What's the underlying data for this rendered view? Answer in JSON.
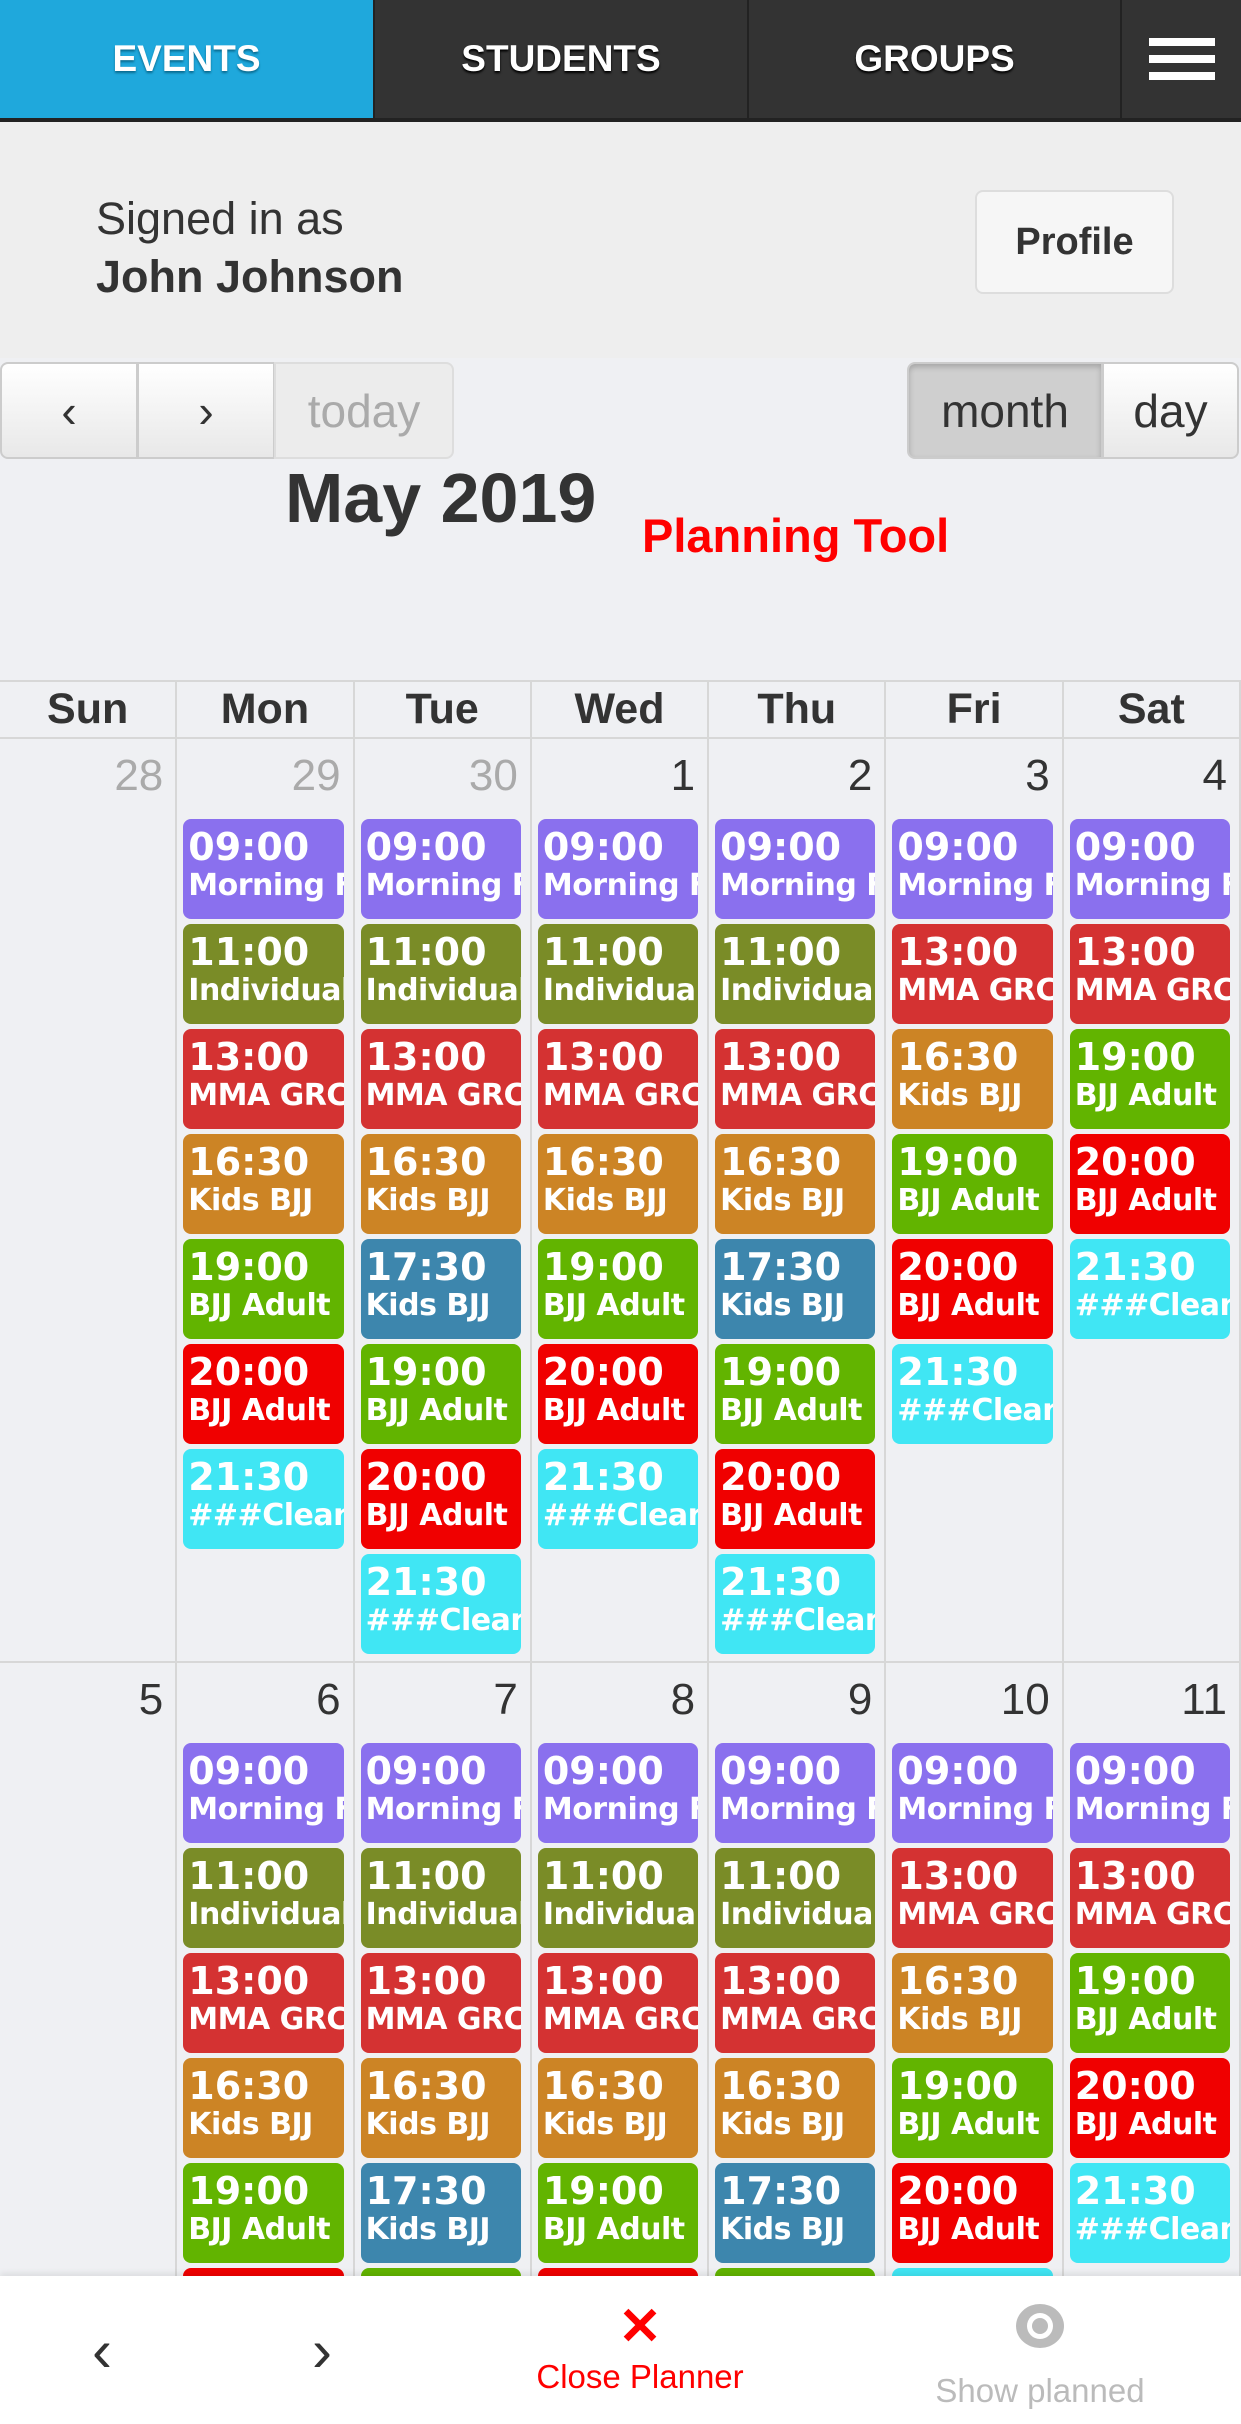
{
  "nav": {
    "tabs": [
      {
        "label": "EVENTS",
        "active": true
      },
      {
        "label": "STUDENTS"
      },
      {
        "label": "GROUPS"
      }
    ],
    "menu_icon": "hamburger-icon",
    "active_color": "#1fa8dc"
  },
  "user": {
    "signed_in_label": "Signed in as",
    "name": "John Johnson",
    "profile_button": "Profile"
  },
  "toolbar": {
    "prev": "‹",
    "next": "›",
    "today": "today",
    "views": [
      {
        "label": "month",
        "active": true
      },
      {
        "label": "day"
      }
    ]
  },
  "calendar": {
    "title": "May 2019",
    "subtitle": "Planning Tool",
    "weekdays": [
      "Sun",
      "Mon",
      "Tue",
      "Wed",
      "Thu",
      "Fri",
      "Sat"
    ],
    "palette": {
      "morning": "#8a70ee",
      "individual": "#7a8c27",
      "mma": "#d43232",
      "kids": "#cc8425",
      "bjj": "#62b400",
      "kids2": "#3d86ad",
      "adult": "#f00000",
      "clean": "#40e6f4"
    },
    "weeks": [
      {
        "days": [
          {
            "date": "28",
            "other": true,
            "events": []
          },
          {
            "date": "29",
            "other": true,
            "events": [
              {
                "time": "09:00",
                "title": "Morning F",
                "color": "morning"
              },
              {
                "time": "11:00",
                "title": "Individual",
                "color": "individual"
              },
              {
                "time": "13:00",
                "title": "MMA GRC",
                "color": "mma"
              },
              {
                "time": "16:30",
                "title": "Kids BJJ",
                "color": "kids"
              },
              {
                "time": "19:00",
                "title": "BJJ Adult",
                "color": "bjj"
              },
              {
                "time": "20:00",
                "title": "BJJ Adult",
                "color": "adult"
              },
              {
                "time": "21:30",
                "title": "###Clean",
                "color": "clean"
              }
            ]
          },
          {
            "date": "30",
            "other": true,
            "events": [
              {
                "time": "09:00",
                "title": "Morning F",
                "color": "morning"
              },
              {
                "time": "11:00",
                "title": "Individual",
                "color": "individual"
              },
              {
                "time": "13:00",
                "title": "MMA GRC",
                "color": "mma"
              },
              {
                "time": "16:30",
                "title": "Kids BJJ",
                "color": "kids"
              },
              {
                "time": "17:30",
                "title": "Kids BJJ",
                "color": "kids2"
              },
              {
                "time": "19:00",
                "title": "BJJ Adult",
                "color": "bjj"
              },
              {
                "time": "20:00",
                "title": "BJJ Adult",
                "color": "adult"
              },
              {
                "time": "21:30",
                "title": "###Clean",
                "color": "clean"
              }
            ]
          },
          {
            "date": "1",
            "events": [
              {
                "time": "09:00",
                "title": "Morning F",
                "color": "morning"
              },
              {
                "time": "11:00",
                "title": "Individual",
                "color": "individual"
              },
              {
                "time": "13:00",
                "title": "MMA GRC",
                "color": "mma"
              },
              {
                "time": "16:30",
                "title": "Kids BJJ",
                "color": "kids"
              },
              {
                "time": "19:00",
                "title": "BJJ Adult",
                "color": "bjj"
              },
              {
                "time": "20:00",
                "title": "BJJ Adult",
                "color": "adult"
              },
              {
                "time": "21:30",
                "title": "###Clean",
                "color": "clean"
              }
            ]
          },
          {
            "date": "2",
            "events": [
              {
                "time": "09:00",
                "title": "Morning F",
                "color": "morning"
              },
              {
                "time": "11:00",
                "title": "Individual",
                "color": "individual"
              },
              {
                "time": "13:00",
                "title": "MMA GRC",
                "color": "mma"
              },
              {
                "time": "16:30",
                "title": "Kids BJJ",
                "color": "kids"
              },
              {
                "time": "17:30",
                "title": "Kids BJJ",
                "color": "kids2"
              },
              {
                "time": "19:00",
                "title": "BJJ Adult",
                "color": "bjj"
              },
              {
                "time": "20:00",
                "title": "BJJ Adult",
                "color": "adult"
              },
              {
                "time": "21:30",
                "title": "###Clean",
                "color": "clean"
              }
            ]
          },
          {
            "date": "3",
            "events": [
              {
                "time": "09:00",
                "title": "Morning F",
                "color": "morning"
              },
              {
                "time": "13:00",
                "title": "MMA GRC",
                "color": "mma"
              },
              {
                "time": "16:30",
                "title": "Kids BJJ",
                "color": "kids"
              },
              {
                "time": "19:00",
                "title": "BJJ Adult",
                "color": "bjj"
              },
              {
                "time": "20:00",
                "title": "BJJ Adult",
                "color": "adult"
              },
              {
                "time": "21:30",
                "title": "###Clean",
                "color": "clean"
              }
            ]
          },
          {
            "date": "4",
            "events": [
              {
                "time": "09:00",
                "title": "Morning F",
                "color": "morning"
              },
              {
                "time": "13:00",
                "title": "MMA GRC",
                "color": "mma"
              },
              {
                "time": "19:00",
                "title": "BJJ Adult",
                "color": "bjj"
              },
              {
                "time": "20:00",
                "title": "BJJ Adult",
                "color": "adult"
              },
              {
                "time": "21:30",
                "title": "###Clean",
                "color": "clean"
              }
            ]
          }
        ]
      },
      {
        "days": [
          {
            "date": "5",
            "events": []
          },
          {
            "date": "6",
            "events": [
              {
                "time": "09:00",
                "title": "Morning F",
                "color": "morning"
              },
              {
                "time": "11:00",
                "title": "Individual",
                "color": "individual"
              },
              {
                "time": "13:00",
                "title": "MMA GRC",
                "color": "mma"
              },
              {
                "time": "16:30",
                "title": "Kids BJJ",
                "color": "kids"
              },
              {
                "time": "19:00",
                "title": "BJJ Adult",
                "color": "bjj"
              },
              {
                "color": "adult"
              }
            ]
          },
          {
            "date": "7",
            "events": [
              {
                "time": "09:00",
                "title": "Morning F",
                "color": "morning"
              },
              {
                "time": "11:00",
                "title": "Individual",
                "color": "individual"
              },
              {
                "time": "13:00",
                "title": "MMA GRC",
                "color": "mma"
              },
              {
                "time": "16:30",
                "title": "Kids BJJ",
                "color": "kids"
              },
              {
                "time": "17:30",
                "title": "Kids BJJ",
                "color": "kids2"
              },
              {
                "color": "bjj"
              }
            ]
          },
          {
            "date": "8",
            "events": [
              {
                "time": "09:00",
                "title": "Morning F",
                "color": "morning"
              },
              {
                "time": "11:00",
                "title": "Individual",
                "color": "individual"
              },
              {
                "time": "13:00",
                "title": "MMA GRC",
                "color": "mma"
              },
              {
                "time": "16:30",
                "title": "Kids BJJ",
                "color": "kids"
              },
              {
                "time": "19:00",
                "title": "BJJ Adult",
                "color": "bjj"
              },
              {
                "color": "adult"
              }
            ]
          },
          {
            "date": "9",
            "events": [
              {
                "time": "09:00",
                "title": "Morning F",
                "color": "morning"
              },
              {
                "time": "11:00",
                "title": "Individual",
                "color": "individual"
              },
              {
                "time": "13:00",
                "title": "MMA GRC",
                "color": "mma"
              },
              {
                "time": "16:30",
                "title": "Kids BJJ",
                "color": "kids"
              },
              {
                "time": "17:30",
                "title": "Kids BJJ",
                "color": "kids2"
              },
              {
                "color": "bjj"
              }
            ]
          },
          {
            "date": "10",
            "events": [
              {
                "time": "09:00",
                "title": "Morning F",
                "color": "morning"
              },
              {
                "time": "13:00",
                "title": "MMA GRC",
                "color": "mma"
              },
              {
                "time": "16:30",
                "title": "Kids BJJ",
                "color": "kids"
              },
              {
                "time": "19:00",
                "title": "BJJ Adult",
                "color": "bjj"
              },
              {
                "time": "20:00",
                "title": "BJJ Adult",
                "color": "adult"
              },
              {
                "color": "clean"
              }
            ]
          },
          {
            "date": "11",
            "events": [
              {
                "time": "09:00",
                "title": "Morning F",
                "color": "morning"
              },
              {
                "time": "13:00",
                "title": "MMA GRC",
                "color": "mma"
              },
              {
                "time": "19:00",
                "title": "BJJ Adult",
                "color": "bjj"
              },
              {
                "time": "20:00",
                "title": "BJJ Adult",
                "color": "adult"
              },
              {
                "time": "21:30",
                "title": "###Clean",
                "color": "clean"
              }
            ]
          }
        ]
      }
    ]
  },
  "bottom_bar": {
    "prev": "‹",
    "next": "›",
    "close_label": "Close Planner",
    "close_icon": "close-icon",
    "close_color": "#f00000",
    "show_label": "Show planned",
    "show_icon": "eye-icon"
  }
}
